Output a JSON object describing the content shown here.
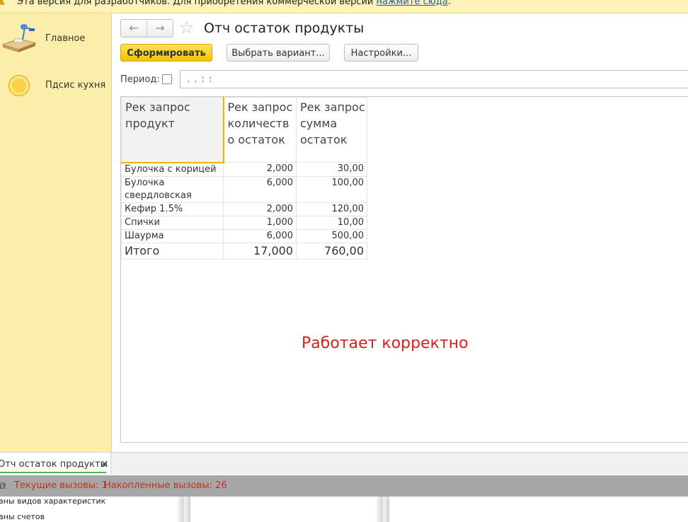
{
  "banner": {
    "text": "Эта версия для разработчиков. Для приобретения коммерческой версии ",
    "link": "нажмите сюда",
    "suffix": "."
  },
  "sidebar": {
    "items": [
      {
        "label": "Главное",
        "icon": "desk-lamp-icon"
      },
      {
        "label": "Пдсис кухня",
        "icon": "ring-icon"
      }
    ]
  },
  "header": {
    "title": "Отч остаток продукты",
    "back_icon": "←",
    "forward_icon": "→",
    "star_icon": "☆"
  },
  "toolbar": {
    "generate_label": "Сформировать",
    "variant_label": "Выбрать вариант...",
    "settings_label": "Настройки..."
  },
  "period": {
    "label": "Период:",
    "value": ". .     : :"
  },
  "report": {
    "columns": [
      "Рек запрос продукт",
      "Рек запрос количеств о остаток",
      "Рек запрос сумма остаток"
    ],
    "rows": [
      {
        "product": "Булочка с корицей",
        "qty": "2,000",
        "sum": "30,00"
      },
      {
        "product": "Булочка свердловская",
        "qty": "6,000",
        "sum": "100,00"
      },
      {
        "product": "Кефир 1.5%",
        "qty": "2,000",
        "sum": "120,00"
      },
      {
        "product": "Спички",
        "qty": "1,000",
        "sum": "10,00"
      },
      {
        "product": "Шаурма",
        "qty": "6,000",
        "sum": "500,00"
      }
    ],
    "total": {
      "label": "Итого",
      "qty": "17,000",
      "sum": "760,00"
    },
    "status_text": "Работает корректно"
  },
  "tabs": [
    {
      "label": "Отч остаток продукты",
      "close": "×"
    }
  ],
  "calls": {
    "current": "Текущие вызовы: 1",
    "accumulated": "Накопленные вызовы: 26"
  },
  "bottom": {
    "line1": "аны видов характеристик",
    "line2": "аны счетов"
  },
  "colors": {
    "sidebar_bg": "#fbeeaa",
    "accent_button": "#f3c200",
    "status_red": "#d62020",
    "calls_red": "#d8261f"
  }
}
